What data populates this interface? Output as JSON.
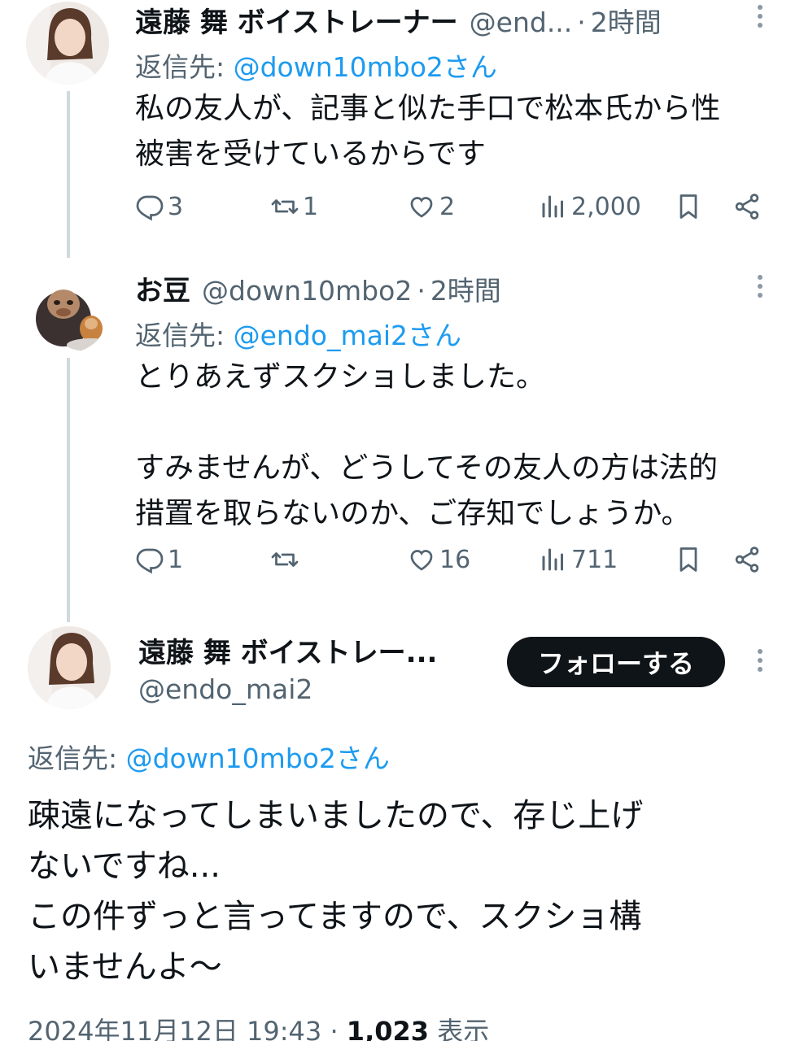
{
  "tweets": [
    {
      "name": "遠藤 舞 ボイストレーナー",
      "handle": "@end...",
      "separator": "·",
      "time": "2時間",
      "reply_prefix": "返信先: ",
      "reply_to": "@down10mbo2さん",
      "text": "私の友人が、記事と似た手口で松本氏から性\n被害を受けているからです",
      "replies": "3",
      "retweets": "1",
      "likes": "2",
      "views": "2,000"
    },
    {
      "name": "お豆",
      "handle": "@down10mbo2",
      "separator": "·",
      "time": "2時間",
      "reply_prefix": "返信先: ",
      "reply_to": "@endo_mai2さん",
      "text": "とりあえずスクショしました。\n\nすみませんが、どうしてその友人の方は法的\n措置を取らないのか、ご存知でしょうか。",
      "replies": "1",
      "retweets": "",
      "likes": "16",
      "views": "711"
    }
  ],
  "main_tweet": {
    "name": "遠藤 舞 ボイストレー...",
    "handle": "@endo_mai2",
    "follow_label": "フォローする",
    "reply_prefix": "返信先: ",
    "reply_to": "@down10mbo2さん",
    "text": "疎遠になってしまいましたので、存じ上げ\nないですね...\nこの件ずっと言ってますので、スクショ構\nいませんよ〜",
    "date": "2024年11月12日 19:43",
    "separator": "·",
    "view_count": "1,023",
    "view_label": "表示"
  },
  "colors": {
    "text": "#0f1419",
    "secondary": "#536471",
    "link": "#1d9bf0",
    "thread_line": "#cfd9de",
    "button": "#0f1419"
  },
  "icons": [
    "reply-icon",
    "retweet-icon",
    "like-icon",
    "views-icon",
    "bookmark-icon",
    "share-icon",
    "more-icon"
  ]
}
